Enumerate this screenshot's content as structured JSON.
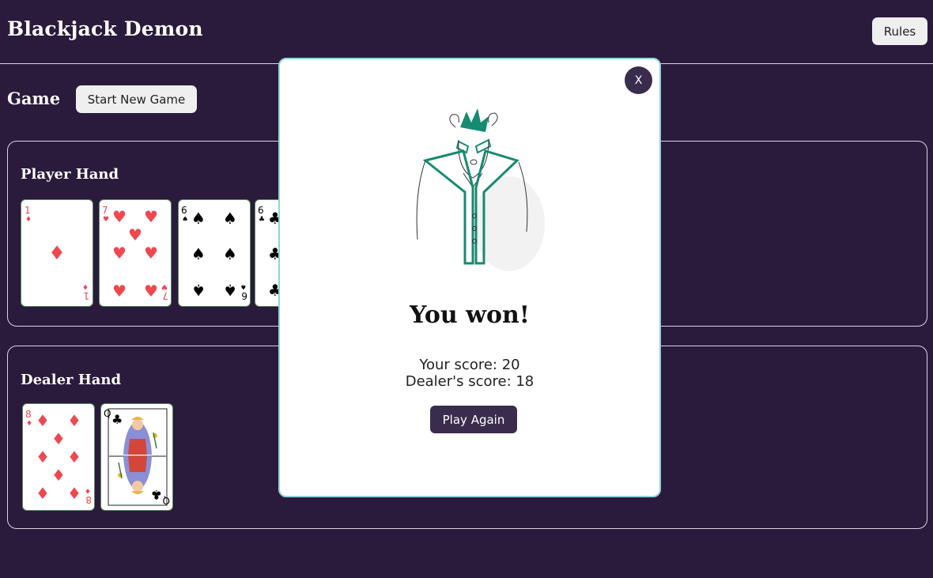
{
  "header": {
    "title": "Blackjack Demon",
    "rules_label": "Rules"
  },
  "game": {
    "label": "Game",
    "new_game_label": "Start New Game"
  },
  "player_hand": {
    "title": "Player Hand",
    "cards": [
      {
        "rank": "1",
        "suit": "diamonds"
      },
      {
        "rank": "7",
        "suit": "hearts"
      },
      {
        "rank": "6",
        "suit": "spades"
      },
      {
        "rank": "6",
        "suit": "clubs"
      }
    ]
  },
  "dealer_hand": {
    "title": "Dealer Hand",
    "cards": [
      {
        "rank": "8",
        "suit": "diamonds"
      },
      {
        "rank": "Q",
        "suit": "clubs"
      }
    ]
  },
  "modal": {
    "close_label": "X",
    "result": "You won!",
    "your_score": "Your score: 20",
    "dealer_score": "Dealer's score: 18",
    "play_again_label": "Play Again",
    "image_icon": "demon-illustration"
  },
  "colors": {
    "background": "#2a1a3b",
    "red_suit": "#f0474f",
    "black_suit": "#000000",
    "modal_border": "#8fd3d8",
    "dark_button": "#3a2c4c",
    "demon_accent": "#178a72"
  }
}
